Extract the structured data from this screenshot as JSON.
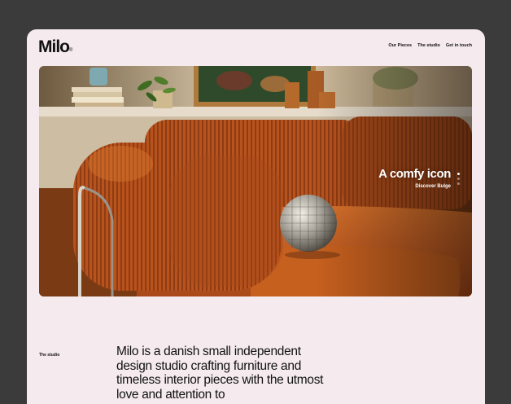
{
  "brand": {
    "name": "Milo",
    "mark": "®"
  },
  "nav": {
    "items": [
      "Our Pieces",
      "The studio",
      "Get in touch"
    ]
  },
  "hero": {
    "title": "A comfy icon",
    "subtitle": "Discover Bulge",
    "image": "orange-corduroy-sofa-with-disco-ball",
    "slides_count": 3,
    "active_slide": 1
  },
  "studio": {
    "label": "The studio",
    "intro": "Milo is a danish small independent design studio crafting furniture and timeless interior pieces with the utmost love and attention to"
  },
  "colors": {
    "outer_background": "#3b3b3b",
    "page_background": "#f5ebee",
    "text": "#111111",
    "sofa": "#c2561a"
  }
}
